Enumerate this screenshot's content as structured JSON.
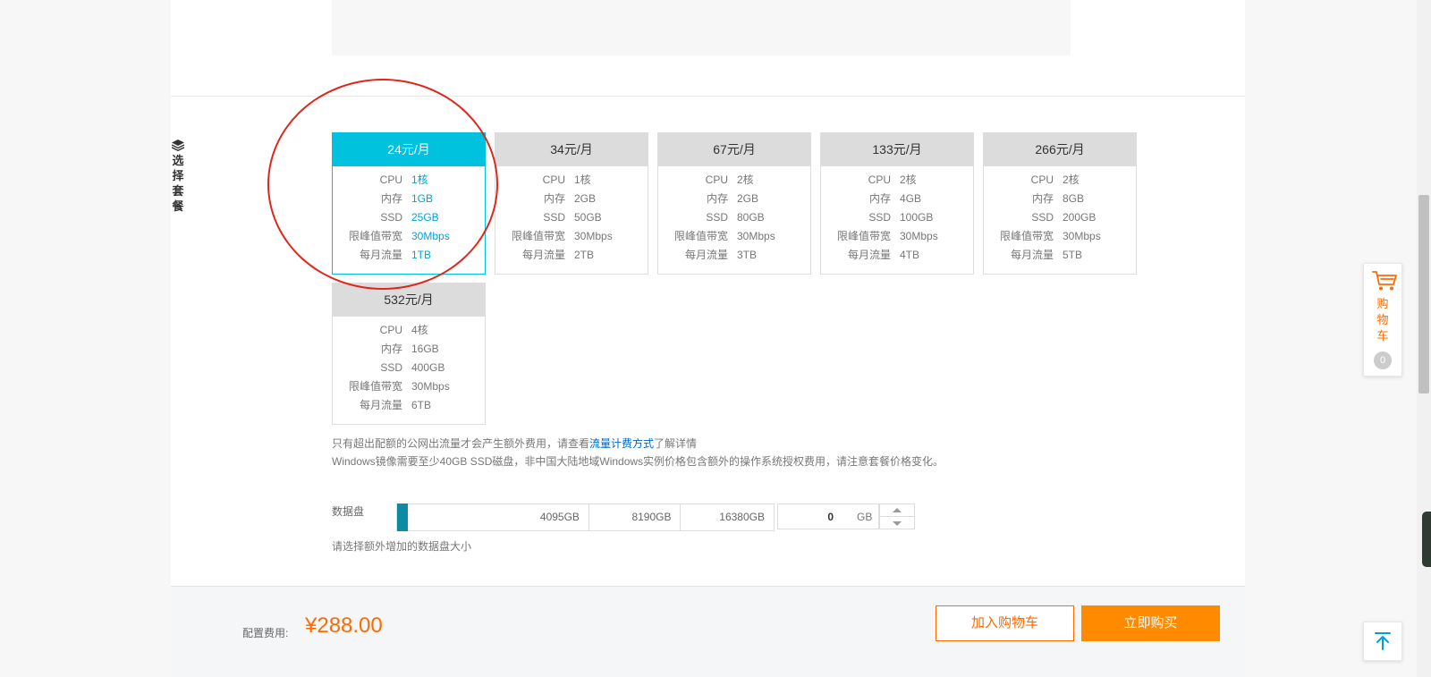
{
  "section": {
    "title": "选择套餐"
  },
  "plans": [
    {
      "price": "24元/月",
      "selected": true,
      "specs": [
        {
          "key": "CPU",
          "value": "1核"
        },
        {
          "key": "内存",
          "value": "1GB"
        },
        {
          "key": "SSD",
          "value": "25GB"
        },
        {
          "key": "限峰值带宽",
          "value": "30Mbps"
        },
        {
          "key": "每月流量",
          "value": "1TB"
        }
      ]
    },
    {
      "price": "34元/月",
      "selected": false,
      "specs": [
        {
          "key": "CPU",
          "value": "1核"
        },
        {
          "key": "内存",
          "value": "2GB"
        },
        {
          "key": "SSD",
          "value": "50GB"
        },
        {
          "key": "限峰值带宽",
          "value": "30Mbps"
        },
        {
          "key": "每月流量",
          "value": "2TB"
        }
      ]
    },
    {
      "price": "67元/月",
      "selected": false,
      "specs": [
        {
          "key": "CPU",
          "value": "2核"
        },
        {
          "key": "内存",
          "value": "2GB"
        },
        {
          "key": "SSD",
          "value": "80GB"
        },
        {
          "key": "限峰值带宽",
          "value": "30Mbps"
        },
        {
          "key": "每月流量",
          "value": "3TB"
        }
      ]
    },
    {
      "price": "133元/月",
      "selected": false,
      "specs": [
        {
          "key": "CPU",
          "value": "2核"
        },
        {
          "key": "内存",
          "value": "4GB"
        },
        {
          "key": "SSD",
          "value": "100GB"
        },
        {
          "key": "限峰值带宽",
          "value": "30Mbps"
        },
        {
          "key": "每月流量",
          "value": "4TB"
        }
      ]
    },
    {
      "price": "266元/月",
      "selected": false,
      "specs": [
        {
          "key": "CPU",
          "value": "2核"
        },
        {
          "key": "内存",
          "value": "8GB"
        },
        {
          "key": "SSD",
          "value": "200GB"
        },
        {
          "key": "限峰值带宽",
          "value": "30Mbps"
        },
        {
          "key": "每月流量",
          "value": "5TB"
        }
      ]
    },
    {
      "price": "532元/月",
      "selected": false,
      "specs": [
        {
          "key": "CPU",
          "value": "4核"
        },
        {
          "key": "内存",
          "value": "16GB"
        },
        {
          "key": "SSD",
          "value": "400GB"
        },
        {
          "key": "限峰值带宽",
          "value": "30Mbps"
        },
        {
          "key": "每月流量",
          "value": "6TB"
        }
      ]
    }
  ],
  "notes": {
    "line1_before": "只有超出配额的公网出流量才会产生额外费用，请查看",
    "line1_link": "流量计费方式",
    "line1_after": "了解详情",
    "line2": "Windows镜像需要至少40GB SSD磁盘，非中国大陆地域Windows实例价格包含额外的操作系统授权费用，请注意套餐价格变化。"
  },
  "disk": {
    "label": "数据盘",
    "ticks": [
      "4095GB",
      "8190GB",
      "16380GB"
    ],
    "value": "0",
    "unit": "GB",
    "hint": "请选择额外增加的数据盘大小"
  },
  "footer": {
    "fee_label": "配置费用:",
    "fee": "¥288.00",
    "add_cart": "加入购物车",
    "buy_now": "立即购买"
  },
  "cart_widget": {
    "label": "购物车",
    "count": "0"
  },
  "icons": {
    "section": "layers-icon",
    "cart": "cart-icon",
    "top": "back-to-top-icon"
  },
  "colors": {
    "accent": "#00c1de",
    "orange": "#ff6a00",
    "annotation": "#e0261b"
  }
}
